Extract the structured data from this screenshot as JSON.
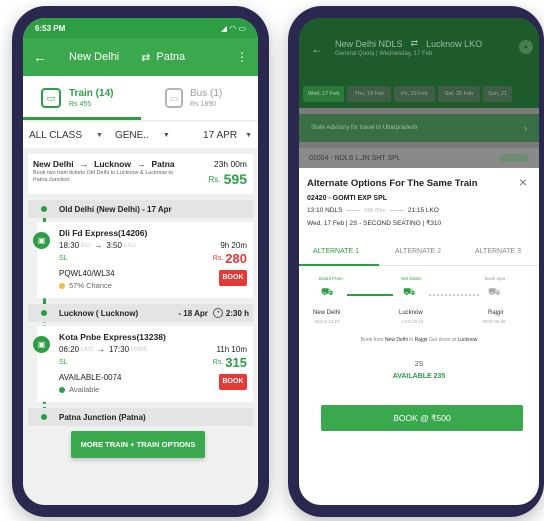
{
  "left": {
    "status": {
      "time": "6:53 PM"
    },
    "header": {
      "from": "New Delhi",
      "to": "Patna"
    },
    "modes": {
      "train": {
        "label": "Train (14)",
        "price": "Rs 455"
      },
      "bus": {
        "label": "Bus (1)",
        "price": "Rs 1890"
      }
    },
    "filters": {
      "class": "ALL CLASS",
      "quota": "GENE..",
      "date": "17 APR"
    },
    "route": {
      "a": "New Delhi",
      "b": "Lucknow",
      "c": "Patna",
      "desc": "Book two train tickets Old Delhi to Lucknow & Lucknow to Patna Junction",
      "duration": "23h 00m",
      "currency": "Rs.",
      "price": "595"
    },
    "station1": "Old Delhi (New Delhi) - 17 Apr",
    "train1": {
      "name": "Dli Fd Express(14206)",
      "dep": "18:30",
      "from_code": "DLI",
      "arr": "3:50",
      "to_code": "LKO",
      "class": "SL",
      "duration": "9h 20m",
      "currency": "Rs.",
      "price": "280",
      "status": "PQWL40/WL34",
      "chance": "57% Chance",
      "book": "BOOK"
    },
    "transfer": {
      "station": "Lucknow ( Lucknow)",
      "wait": "- 18 Apr",
      "time": "2:30 h"
    },
    "train2": {
      "name": "Kota Pnbe Express(13238)",
      "dep": "06:20",
      "from_code": "LKO",
      "arr": "17:30",
      "to_code": "PNBE",
      "class": "SL",
      "duration": "11h 10m",
      "currency": "Rs.",
      "price": "315",
      "status": "AVAILABLE-0074",
      "avail": "Available",
      "book": "BOOK"
    },
    "station3": "Patna Junction (Patna)",
    "more_button": "MORE TRAIN + TRAIN OPTIONS"
  },
  "right": {
    "header": {
      "from": "New Delhi NDLS",
      "to": "Lucknow LKO",
      "sub": "General Quota | Wednesday, 17 Feb"
    },
    "dates": [
      "Wed, 17 Feb",
      "Thu, 18 Feb",
      "Fri, 19 Feb",
      "Sat, 20 Feb",
      "Sun, 21"
    ],
    "advisory": "State Advisory for travel to Uttarpradesh",
    "train_row": {
      "name": "02004 - NDLS L.JN SHT SPL"
    },
    "modal": {
      "title": "Alternate Options For The Same Train",
      "train": "02420 - GOMTI EXP SPL",
      "dep": "13:10 NDLS",
      "dur": "09h 00m",
      "arr": "21:15 LKO",
      "info": "Wed, 17 Feb  |  2S - SECOND SEATING  |  ₹310",
      "tabs": [
        "ALTERNATE 1",
        "ALTERNATE 2",
        "ALTERNATE 3"
      ],
      "board_label": "Board From",
      "get_label": "Get Down",
      "book_label": "Book upto",
      "board_station": "New Delhi",
      "board_code": "NDLS 13:10",
      "get_station": "Lucknow",
      "get_code": "LKO 21:15",
      "book_station": "Rajgir",
      "book_code": "RGD 06:36",
      "note_pre": "Book from ",
      "note_from": "New Delhi",
      "note_mid": " to ",
      "note_to": "Rajgir",
      "note_mid2": " Get down at ",
      "note_at": "Lucknow",
      "seat_class": "2S",
      "availability": "AVAILABLE 235",
      "book_button": "BOOK @ ₹500"
    }
  },
  "colors": {
    "brand_green": "#2e9e45",
    "price_red": "#e53935",
    "phone_frame": "#2b2850"
  }
}
